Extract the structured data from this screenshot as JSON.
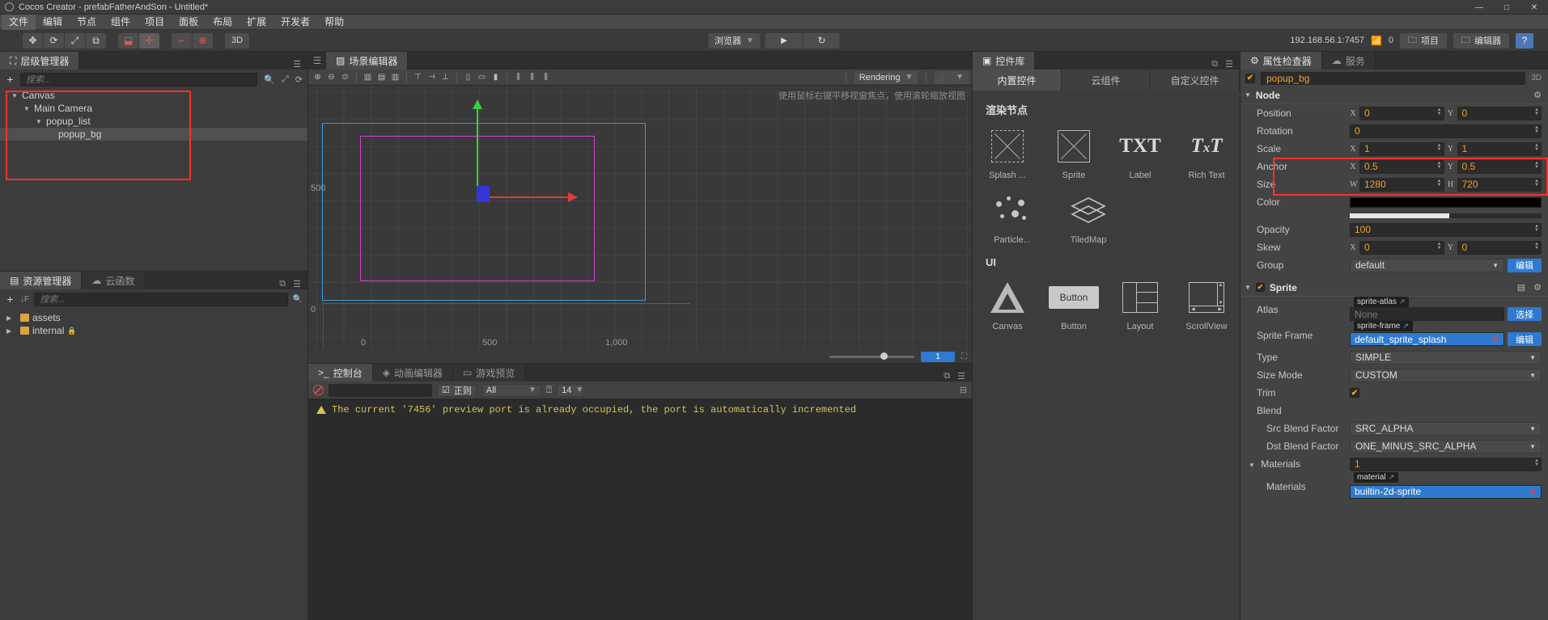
{
  "titlebar": {
    "title": "Cocos Creator - prefabFatherAndSon - Untitled*",
    "minimize": "—",
    "maximize": "□",
    "close": "✕"
  },
  "menubar": {
    "items": [
      "文件",
      "编辑",
      "节点",
      "组件",
      "项目",
      "面板",
      "布局",
      "扩展",
      "开发者",
      "帮助"
    ]
  },
  "toolbar": {
    "transform_tools": [
      "move-icon",
      "rotate-icon",
      "scale-icon",
      "rect-icon"
    ],
    "pivot_tools": [
      "pivot-icon",
      "anchor-icon"
    ],
    "coord_tools": [
      "local-icon",
      "global-icon"
    ],
    "dim_label": "3D",
    "preview_target": "浏览器",
    "play_label": "▶",
    "refresh_label": "↻",
    "ip_address": "192.168.56.1:7457",
    "device_count": "0",
    "project_button": "项目",
    "editor_button": "编辑器",
    "help_button": "?"
  },
  "hierarchy": {
    "tab_label": "层级管理器",
    "search_placeholder": "搜索...",
    "add_label": "+",
    "nodes": [
      {
        "label": "Canvas",
        "depth": 0,
        "expanded": true,
        "selected": false
      },
      {
        "label": "Main Camera",
        "depth": 1,
        "expanded": true,
        "selected": false
      },
      {
        "label": "popup_list",
        "depth": 2,
        "expanded": true,
        "selected": false
      },
      {
        "label": "popup_bg",
        "depth": 3,
        "expanded": false,
        "selected": true
      }
    ]
  },
  "assets": {
    "tabs": [
      {
        "label": "资源管理器",
        "active": true
      },
      {
        "label": "云函数",
        "active": false
      }
    ],
    "search_placeholder": "搜索...",
    "add_label": "+",
    "items": [
      {
        "label": "assets",
        "locked": false,
        "expanded": false
      },
      {
        "label": "internal",
        "locked": true,
        "expanded": false
      }
    ]
  },
  "scene": {
    "tab_label": "场景编辑器",
    "rendering_label": "Rendering",
    "hint_text": "使用鼠标右键平移视窗焦点，使用滚轮缩放视图",
    "ruler_left_500": "500",
    "ruler_left_0": "0",
    "ruler_bottom_0": "0",
    "ruler_bottom_500": "500",
    "ruler_bottom_1000": "1,000",
    "zoom_value": "1"
  },
  "console": {
    "tabs": [
      {
        "label": "控制台",
        "active": true
      },
      {
        "label": "动画编辑器",
        "active": false
      },
      {
        "label": "游戏预览",
        "active": false
      }
    ],
    "filter_placeholder": "",
    "regex_label": "正则",
    "level_label": "All",
    "font_size": "14",
    "messages": [
      {
        "type": "warning",
        "text": "The current '7456' preview port is already occupied, the port is automatically incremented"
      }
    ]
  },
  "widget_library": {
    "tab_label": "控件库",
    "tabs": [
      {
        "label": "内置控件",
        "active": true
      },
      {
        "label": "云组件",
        "active": false
      },
      {
        "label": "自定义控件",
        "active": false
      }
    ],
    "sections": [
      {
        "title": "渲染节点",
        "items": [
          {
            "label": "Splash ...",
            "icon": "splash-icon"
          },
          {
            "label": "Sprite",
            "icon": "sprite-icon"
          },
          {
            "label": "Label",
            "icon": "label-icon"
          },
          {
            "label": "Rich Text",
            "icon": "richtext-icon"
          },
          {
            "label": "Particle...",
            "icon": "particle-icon"
          },
          {
            "label": "TiledMap",
            "icon": "tiledmap-icon"
          }
        ]
      },
      {
        "title": "UI",
        "items": [
          {
            "label": "Canvas",
            "icon": "canvas-icon"
          },
          {
            "label": "Button",
            "icon": "button-icon"
          },
          {
            "label": "Layout",
            "icon": "layout-icon"
          },
          {
            "label": "ScrollView",
            "icon": "scrollview-icon"
          }
        ]
      }
    ]
  },
  "inspector": {
    "tabs": [
      {
        "label": "属性检查器",
        "active": true
      },
      {
        "label": "服务",
        "active": false
      }
    ],
    "node_name": "popup_bg",
    "node_enabled": true,
    "dimension_badge": "3D",
    "node_section": {
      "title": "Node",
      "position": {
        "label": "Position",
        "x_axis": "X",
        "x": "0",
        "y_axis": "Y",
        "y": "0"
      },
      "rotation": {
        "label": "Rotation",
        "value": "0"
      },
      "scale": {
        "label": "Scale",
        "x_axis": "X",
        "x": "1",
        "y_axis": "Y",
        "y": "1"
      },
      "anchor": {
        "label": "Anchor",
        "x_axis": "X",
        "x": "0.5",
        "y_axis": "Y",
        "y": "0.5"
      },
      "size": {
        "label": "Size",
        "w_axis": "W",
        "w": "1280",
        "h_axis": "H",
        "h": "720"
      },
      "color": {
        "label": "Color",
        "value": "#000000"
      },
      "opacity": {
        "label": "Opacity",
        "value": "100"
      },
      "skew": {
        "label": "Skew",
        "x_axis": "X",
        "x": "0",
        "y_axis": "Y",
        "y": "0"
      },
      "group": {
        "label": "Group",
        "value": "default",
        "edit_button": "编辑"
      }
    },
    "sprite_section": {
      "title": "Sprite",
      "enabled": true,
      "atlas": {
        "label": "Atlas",
        "tag": "sprite-atlas",
        "value": "None",
        "button": "选择"
      },
      "sprite_frame": {
        "label": "Sprite Frame",
        "tag": "sprite-frame",
        "value": "default_sprite_splash",
        "button": "编辑"
      },
      "type": {
        "label": "Type",
        "value": "SIMPLE"
      },
      "size_mode": {
        "label": "Size Mode",
        "value": "CUSTOM"
      },
      "trim": {
        "label": "Trim",
        "checked": true
      },
      "blend": {
        "label": "Blend"
      },
      "src_blend": {
        "label": "Src Blend Factor",
        "value": "SRC_ALPHA"
      },
      "dst_blend": {
        "label": "Dst Blend Factor",
        "value": "ONE_MINUS_SRC_ALPHA"
      },
      "materials_count": {
        "label": "Materials",
        "value": "1"
      },
      "materials": {
        "label": "Materials",
        "tag": "material",
        "value": "builtin-2d-sprite"
      }
    }
  }
}
